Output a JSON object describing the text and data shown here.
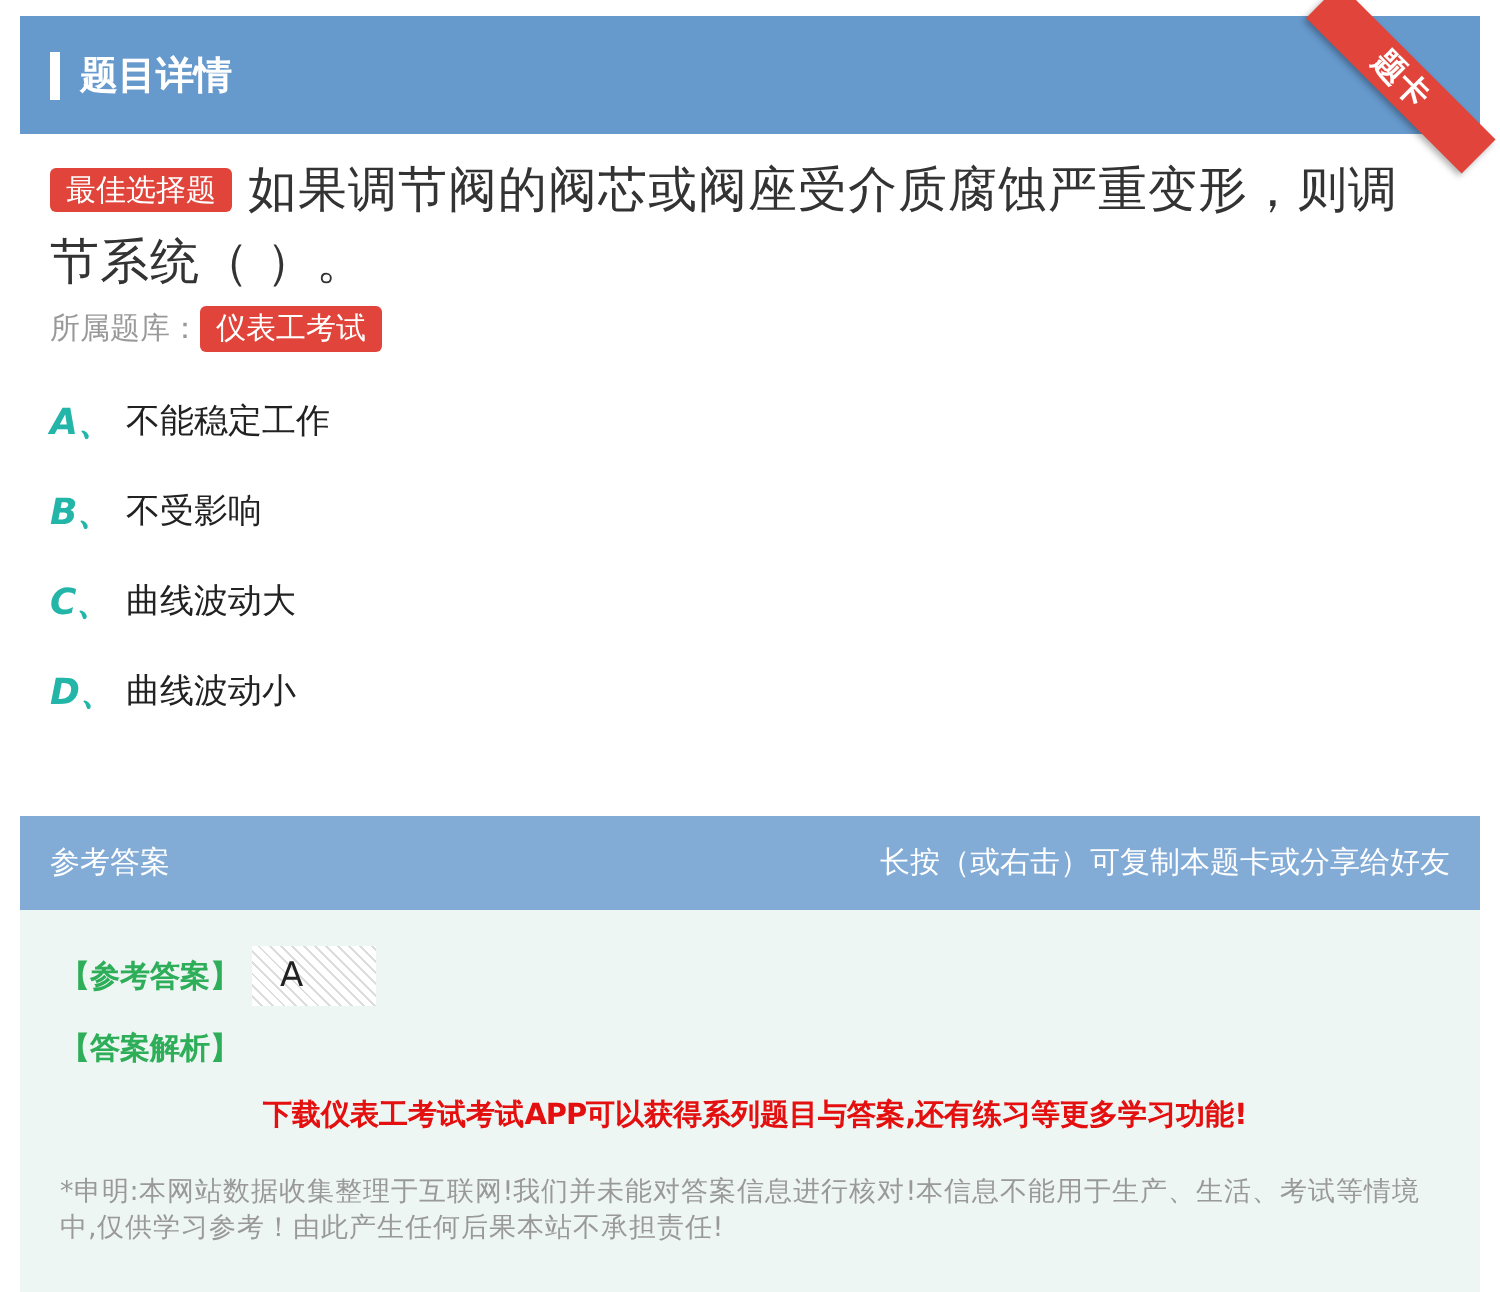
{
  "header": {
    "title": "题目详情",
    "ribbon": "题卡"
  },
  "question": {
    "type_badge": "最佳选择题",
    "text": "如果调节阀的阀芯或阀座受介质腐蚀严重变形，则调节系统（ ）。",
    "bank_label": "所属题库：",
    "bank": "仪表工考试"
  },
  "options": [
    {
      "letter": "A、",
      "text": "不能稳定工作"
    },
    {
      "letter": "B、",
      "text": "不受影响"
    },
    {
      "letter": "C、",
      "text": "曲线波动大"
    },
    {
      "letter": "D、",
      "text": "曲线波动小"
    }
  ],
  "answer_section": {
    "title": "参考答案",
    "hint": "长按（或右击）可复制本题卡或分享给好友",
    "answer_label": "【参考答案】",
    "answer": "A",
    "analysis_label": "【答案解析】",
    "promo": "下载仪表工考试考试APP可以获得系列题目与答案,还有练习等更多学习功能!",
    "disclaimer": "*申明:本网站数据收集整理于互联网!我们并未能对答案信息进行核对!本信息不能用于生产、生活、考试等情境中,仅供学习参考！由此产生任何后果本站不承担责任!"
  }
}
